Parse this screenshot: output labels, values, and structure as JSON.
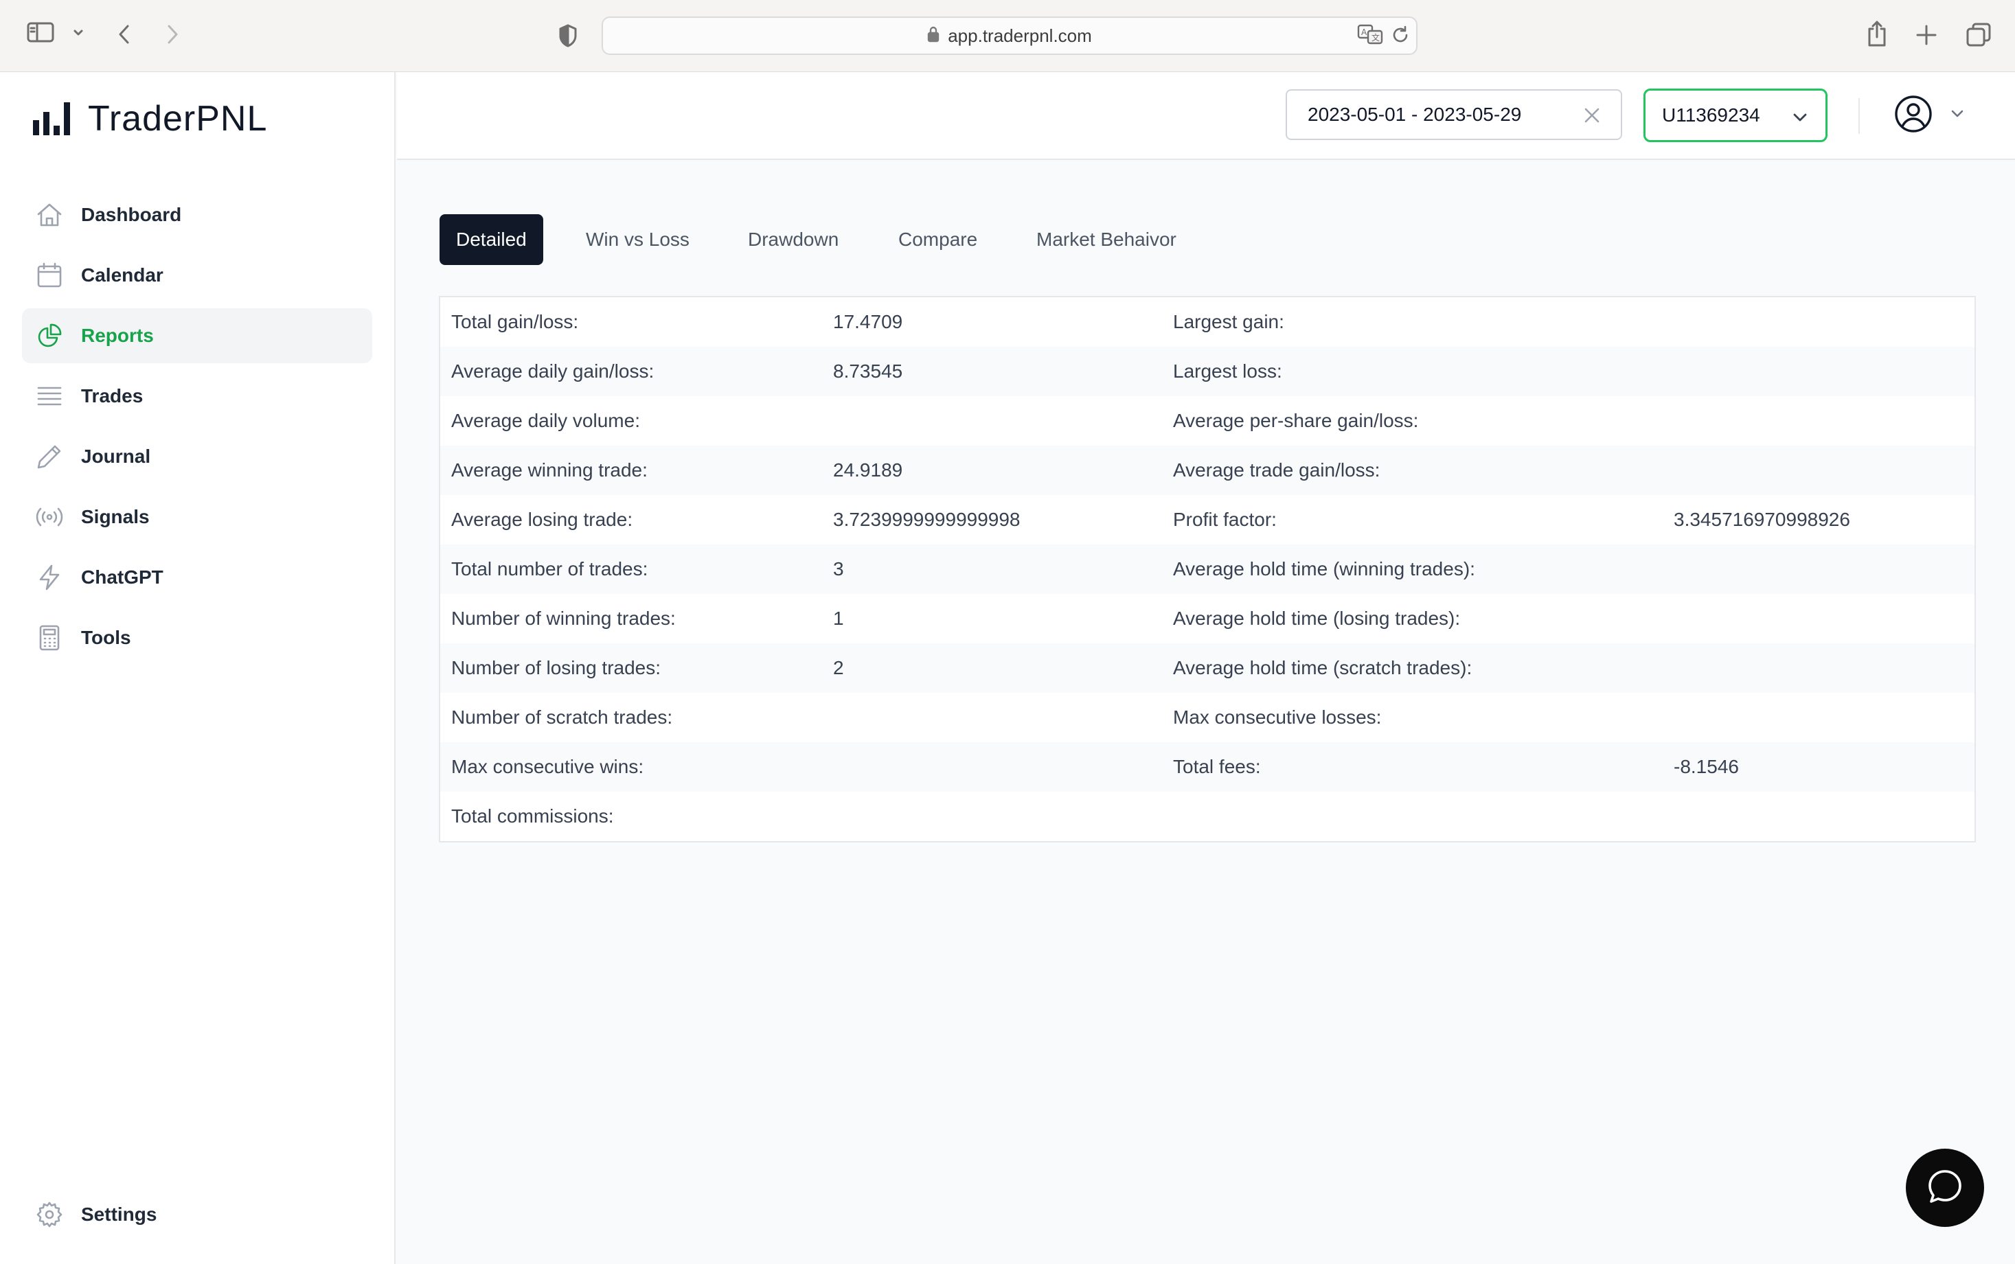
{
  "browser": {
    "url": "app.traderpnl.com"
  },
  "app": {
    "name": "TraderPNL"
  },
  "sidebar": {
    "items": [
      {
        "label": "Dashboard",
        "icon": "home-icon"
      },
      {
        "label": "Calendar",
        "icon": "calendar-icon"
      },
      {
        "label": "Reports",
        "icon": "pie-chart-icon",
        "active": true
      },
      {
        "label": "Trades",
        "icon": "list-icon"
      },
      {
        "label": "Journal",
        "icon": "pencil-icon"
      },
      {
        "label": "Signals",
        "icon": "broadcast-icon"
      },
      {
        "label": "ChatGPT",
        "icon": "lightning-icon"
      },
      {
        "label": "Tools",
        "icon": "calculator-icon"
      }
    ],
    "settings_label": "Settings"
  },
  "header": {
    "date_range": "2023-05-01 - 2023-05-29",
    "account": "U11369234"
  },
  "tabs": [
    {
      "label": "Detailed",
      "active": true
    },
    {
      "label": "Win vs Loss"
    },
    {
      "label": "Drawdown"
    },
    {
      "label": "Compare"
    },
    {
      "label": "Market Behaivor"
    }
  ],
  "stats": {
    "rows": [
      {
        "l1": "Total gain/loss:",
        "v1": "17.4709",
        "l2": "Largest gain:",
        "v2": ""
      },
      {
        "l1": "Average daily gain/loss:",
        "v1": "8.73545",
        "l2": "Largest loss:",
        "v2": ""
      },
      {
        "l1": "Average daily volume:",
        "v1": "",
        "l2": "Average per-share gain/loss:",
        "v2": ""
      },
      {
        "l1": "Average winning trade:",
        "v1": "24.9189",
        "l2": "Average trade gain/loss:",
        "v2": ""
      },
      {
        "l1": "Average losing trade:",
        "v1": "3.7239999999999998",
        "l2": "Profit factor:",
        "v2": "3.345716970998926"
      },
      {
        "l1": "Total number of trades:",
        "v1": "3",
        "l2": "Average hold time (winning trades):",
        "v2": ""
      },
      {
        "l1": "Number of winning trades:",
        "v1": "1",
        "l2": "Average hold time (losing trades):",
        "v2": ""
      },
      {
        "l1": "Number of losing trades:",
        "v1": "2",
        "l2": "Average hold time (scratch trades):",
        "v2": ""
      },
      {
        "l1": "Number of scratch trades:",
        "v1": "",
        "l2": "Max consecutive losses:",
        "v2": ""
      },
      {
        "l1": "Max consecutive wins:",
        "v1": "",
        "l2": "Total fees:",
        "v2": "-8.1546"
      },
      {
        "l1": "Total commissions:",
        "v1": "",
        "l2": "",
        "v2": ""
      }
    ]
  },
  "colors": {
    "accent": "#16a34a",
    "account_border": "#22c55e",
    "active_tab": "#111827"
  }
}
